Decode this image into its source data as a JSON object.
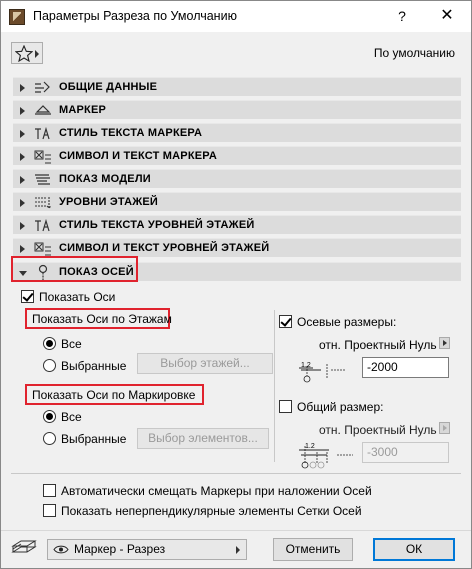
{
  "window": {
    "title": "Параметры Разреза по Умолчанию",
    "help_label": "?",
    "close_label": "✕"
  },
  "preset": {
    "label": "По умолчанию"
  },
  "panels": [
    {
      "label": "ОБЩИЕ ДАННЫЕ",
      "icon": "general-settings-icon"
    },
    {
      "label": "МАРКЕР",
      "icon": "marker-icon"
    },
    {
      "label": "СТИЛЬ ТЕКСТА МАРКЕРА",
      "icon": "text-style-icon"
    },
    {
      "label": "СИМВОЛ И ТЕКСТ МАРКЕРА",
      "icon": "symbol-text-icon"
    },
    {
      "label": "ПОКАЗ МОДЕЛИ",
      "icon": "model-display-icon"
    },
    {
      "label": "УРОВНИ ЭТАЖЕЙ",
      "icon": "story-levels-icon"
    },
    {
      "label": "СТИЛЬ ТЕКСТА УРОВНЕЙ ЭТАЖЕЙ",
      "icon": "text-style-icon"
    },
    {
      "label": "СИМВОЛ И ТЕКСТ УРОВНЕЙ ЭТАЖЕЙ",
      "icon": "symbol-text-icon"
    },
    {
      "label": "ПОКАЗ ОСЕЙ",
      "icon": "grid-display-icon"
    }
  ],
  "grid": {
    "show_grid_label": "Показать Оси",
    "show_by_stories_label": "Показать Оси по Этажам",
    "stories_all_label": "Все",
    "stories_selected_label": "Выбранные",
    "select_stories_button": "Выбор этажей...",
    "show_by_marker_label": "Показать Оси по Маркировке",
    "marker_all_label": "Все",
    "marker_selected_label": "Выбранные",
    "select_elements_button": "Выбор элементов...",
    "axis_dims_label": "Осевые размеры:",
    "axis_dims_ref": "отн. Проектный Нуль",
    "axis_dims_value": "-2000",
    "overall_dim_label": "Общий размер:",
    "overall_dim_ref": "отн. Проектный Нуль",
    "overall_dim_value": "-3000",
    "auto_offset_label": "Автоматически смещать Маркеры при наложении Осей",
    "non_perp_label": "Показать неперпендикулярные элементы Сетки Осей"
  },
  "footer": {
    "view_select_value": "Маркер - Разрез",
    "cancel_label": "Отменить",
    "ok_label": "ОК"
  }
}
